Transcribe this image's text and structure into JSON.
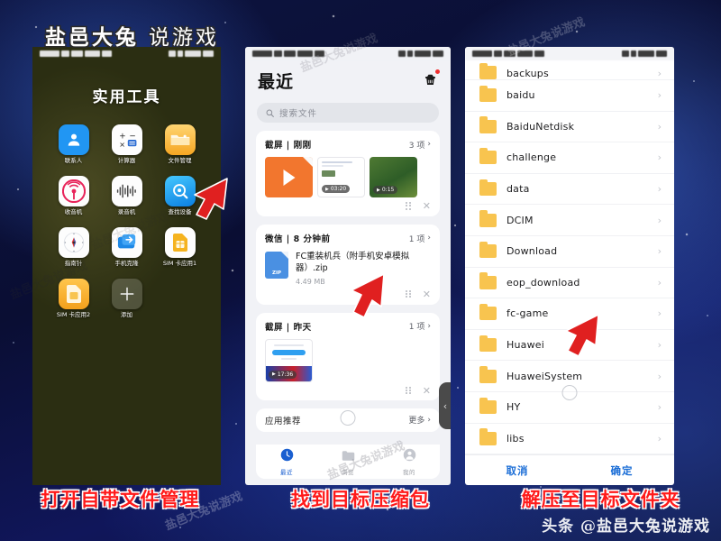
{
  "watermarks": {
    "top": "盐邑大兔",
    "top_light": "说游戏",
    "bottom": "头条 @盐邑大兔说游戏",
    "diagonal": "盐邑大兔说游戏"
  },
  "captions": [
    "打开自带文件管理",
    "找到目标压缩包",
    "解压至目标文件夹"
  ],
  "panel1": {
    "statusbar": {
      "carrier": "中国移动",
      "signal": "4G",
      "battery": "80%",
      "time": "1:23"
    },
    "folder_title": "实用工具",
    "apps": [
      {
        "label": "联系人",
        "icon": "contacts-icon"
      },
      {
        "label": "计算器",
        "icon": "calculator-icon"
      },
      {
        "label": "文件管理",
        "icon": "file-manager-icon"
      },
      {
        "label": "收音机",
        "icon": "radio-icon"
      },
      {
        "label": "录音机",
        "icon": "recorder-icon"
      },
      {
        "label": "查找设备",
        "icon": "find-device-icon"
      },
      {
        "label": "指南针",
        "icon": "compass-icon"
      },
      {
        "label": "手机克隆",
        "icon": "phone-clone-icon"
      },
      {
        "label": "SIM 卡应用1",
        "icon": "sim-card-icon"
      },
      {
        "label": "SIM 卡应用2",
        "icon": "sim-card-icon"
      },
      {
        "label": "添加",
        "icon": "plus-icon"
      }
    ]
  },
  "panel2": {
    "statusbar": {
      "carrier": "中国移动",
      "signal": "4G",
      "battery": "80%",
      "time": "1:23"
    },
    "title": "最近",
    "header_icon": "cleanup-trash-icon",
    "search": {
      "placeholder": "搜索文件",
      "icon": "search-icon"
    },
    "groups": [
      {
        "title": "截屏 | 刚刚",
        "count": "3 项",
        "kind": "thumbs",
        "thumbs": [
          {
            "type": "video",
            "badge": ""
          },
          {
            "type": "doc",
            "badge": "03:20"
          },
          {
            "type": "photo",
            "badge": "0:15"
          }
        ]
      },
      {
        "title": "微信 | 8 分钟前",
        "count": "1 项",
        "kind": "file",
        "file": {
          "name": "FC重装机兵（附手机安卓模拟器）.zip",
          "size": "4.49 MB",
          "icon": "zip-file-icon",
          "icon_label": "ZIP"
        }
      },
      {
        "title": "截屏 | 昨天",
        "count": "1 项",
        "kind": "thumbs",
        "thumbs": [
          {
            "type": "doc",
            "badge": "17:36"
          }
        ]
      }
    ],
    "recommend": {
      "label": "应用推荐",
      "more": "更多"
    },
    "tabs": [
      {
        "label": "最近",
        "icon": "clock-icon",
        "active": true
      },
      {
        "label": "浏览",
        "icon": "folder-icon",
        "active": false
      },
      {
        "label": "我的",
        "icon": "person-icon",
        "active": false
      }
    ],
    "edge_handle_icon": "chevron-left-icon"
  },
  "panel3": {
    "statusbar": {
      "carrier": "中国移动",
      "signal": "4G",
      "battery": "80%",
      "time": "1:23"
    },
    "folders": [
      {
        "name": "backups",
        "clipped": true
      },
      {
        "name": "baidu",
        "clipped": false
      },
      {
        "name": "BaiduNetdisk",
        "clipped": false
      },
      {
        "name": "challenge",
        "clipped": false
      },
      {
        "name": "data",
        "clipped": false
      },
      {
        "name": "DCIM",
        "clipped": false
      },
      {
        "name": "Download",
        "clipped": false
      },
      {
        "name": "eop_download",
        "clipped": false
      },
      {
        "name": "fc-game",
        "clipped": false
      },
      {
        "name": "Huawei",
        "clipped": false
      },
      {
        "name": "HuaweiSystem",
        "clipped": false
      },
      {
        "name": "HY",
        "clipped": false
      },
      {
        "name": "libs",
        "clipped": false
      }
    ],
    "buttons": {
      "cancel": "取消",
      "confirm": "确定"
    }
  },
  "colors": {
    "accent_blue": "#1a6dd6",
    "folder_yellow": "#f8c44f",
    "arrow_red": "#e02020",
    "caption_red": "#ff1a1a",
    "zip_blue": "#4a90e2",
    "video_orange": "#f2762e"
  }
}
